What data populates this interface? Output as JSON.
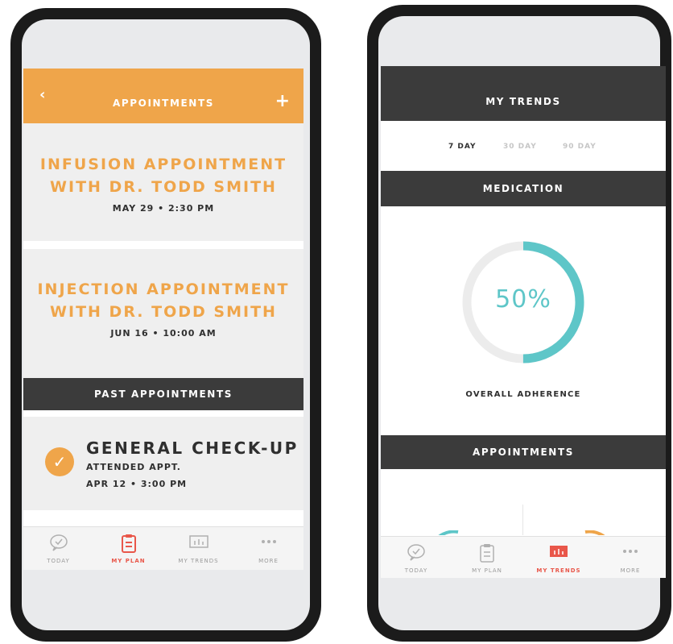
{
  "left_screen": {
    "header": {
      "back_icon": "chevron-left-icon",
      "back_glyph": "‹",
      "title": "APPOINTMENTS",
      "add_icon": "plus-icon",
      "add_glyph": "+"
    },
    "upcoming": [
      {
        "line1": "INFUSION APPOINTMENT",
        "line2": "WITH DR. TODD SMITH",
        "when": "MAY 29 • 2:30 PM"
      },
      {
        "line1": "INJECTION APPOINTMENT",
        "line2": "WITH DR. TODD SMITH",
        "when": "JUN 16 • 10:00 AM"
      }
    ],
    "past_header": "PAST APPOINTMENTS",
    "past": {
      "title": "GENERAL CHECK-UP",
      "status": "ATTENDED APPT.",
      "when": "APR 12 • 3:00 PM",
      "check_glyph": "✓"
    },
    "tabs": [
      {
        "label": "TODAY",
        "icon": "chat-check-icon",
        "active": false
      },
      {
        "label": "MY PLAN",
        "icon": "clipboard-icon",
        "active": true
      },
      {
        "label": "MY TRENDS",
        "icon": "chart-icon",
        "active": false
      },
      {
        "label": "MORE",
        "icon": "dots-icon",
        "active": false
      }
    ]
  },
  "right_screen": {
    "header": "MY TRENDS",
    "ranges": [
      {
        "label": "7 DAY",
        "active": true
      },
      {
        "label": "30 DAY",
        "active": false
      },
      {
        "label": "90 DAY",
        "active": false
      }
    ],
    "medication_header": "MEDICATION",
    "adherence_value": "50%",
    "adherence_fraction": 0.5,
    "adherence_label": "OVERALL ADHERENCE",
    "appointments_header": "APPOINTMENTS",
    "tabs": [
      {
        "label": "TODAY",
        "icon": "chat-check-icon",
        "active": false
      },
      {
        "label": "MY PLAN",
        "icon": "clipboard-icon",
        "active": false
      },
      {
        "label": "MY TRENDS",
        "icon": "chart-icon",
        "active": true
      },
      {
        "label": "MORE",
        "icon": "dots-icon",
        "active": false
      }
    ]
  },
  "colors": {
    "accent_orange": "#efa54a",
    "accent_teal": "#5ec6c8",
    "dark_bar": "#3b3b3b",
    "active_tab": "#e9574a"
  }
}
